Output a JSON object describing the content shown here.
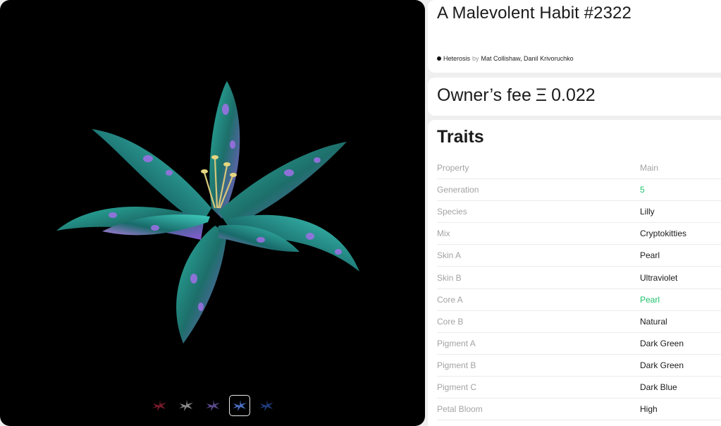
{
  "nft": {
    "title": "A Malevolent Habit #2322",
    "collection": "Heterosis",
    "by": "by",
    "authors": "Mat Collishaw, Danil Krivoruchko"
  },
  "fee": {
    "label": "Owner’s fee",
    "symbol": "Ξ",
    "value": "0.022"
  },
  "traits": {
    "title": "Traits",
    "header": {
      "key": "Property",
      "value": "Main"
    },
    "rows": [
      {
        "key": "Generation",
        "value": "5"
      },
      {
        "key": "Species",
        "value": "Lilly"
      },
      {
        "key": "Mix",
        "value": "Cryptokitties"
      },
      {
        "key": "Skin A",
        "value": "Pearl"
      },
      {
        "key": "Skin B",
        "value": "Ultraviolet"
      },
      {
        "key": "Core A",
        "value": "Pearl"
      },
      {
        "key": "Core B",
        "value": "Natural"
      },
      {
        "key": "Pigment A",
        "value": "Dark Green"
      },
      {
        "key": "Pigment B",
        "value": "Dark Green"
      },
      {
        "key": "Pigment C",
        "value": "Dark Blue"
      },
      {
        "key": "Petal Bloom",
        "value": "High"
      }
    ]
  },
  "viewer": {
    "thumbnails": [
      {
        "icon": "flower-thumb-red-icon",
        "color": "#7a1a2a",
        "active": false
      },
      {
        "icon": "flower-thumb-grey-icon",
        "color": "#8a8a8a",
        "active": false
      },
      {
        "icon": "flower-thumb-purple-icon",
        "color": "#5a4a8a",
        "active": false
      },
      {
        "icon": "flower-thumb-blue-icon",
        "color": "#4a6fc0",
        "active": true
      },
      {
        "icon": "flower-thumb-navy-icon",
        "color": "#1f3a7a",
        "active": false
      }
    ]
  },
  "colors": {
    "accent": "#1fc26b",
    "muted": "#a3a3a3",
    "viewer_bg": "#000000"
  }
}
